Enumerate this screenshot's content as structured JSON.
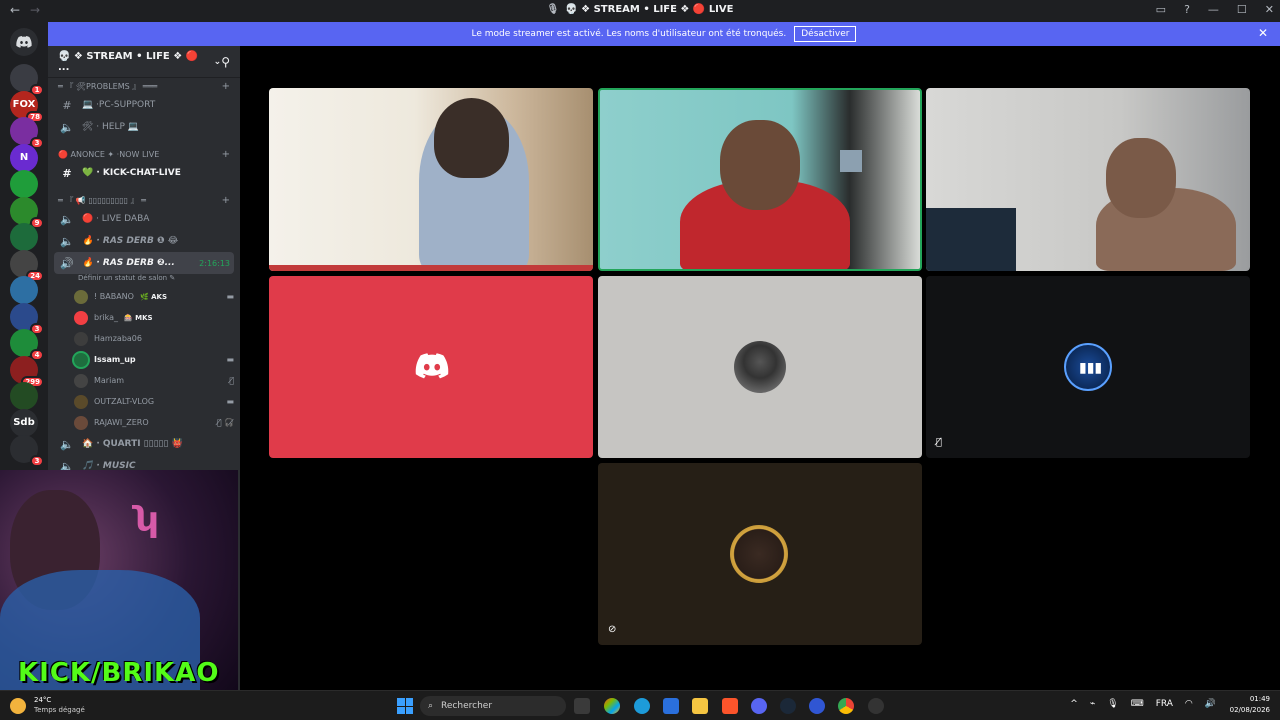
{
  "titlebar": {
    "title": "💀 ❖ STREAM • LIFE ❖ 🔴 LIVE",
    "back": "←",
    "forward": "→",
    "mic_icon": "🎙"
  },
  "banner": {
    "text": "Le mode streamer est activé. Les noms d'utilisateur ont été tronqués.",
    "button": "Désactiver",
    "close": "✕"
  },
  "guilds": [
    {
      "label": "",
      "badge": "1",
      "color": "#3a3c43"
    },
    {
      "label": "FOX",
      "badge": "78",
      "color": "#b3261e"
    },
    {
      "label": "",
      "badge": "3",
      "color": "#7a2ea0"
    },
    {
      "label": "N",
      "badge": "",
      "color": "#6a2bd0"
    },
    {
      "label": "",
      "badge": "",
      "color": "#1f9d3a"
    },
    {
      "label": "",
      "badge": "9",
      "color": "#2c8a2c"
    },
    {
      "label": "",
      "badge": "",
      "color": "#1d6b3b"
    },
    {
      "label": "",
      "badge": "24",
      "color": "#444"
    },
    {
      "label": "",
      "badge": "",
      "color": "#2d6fa3"
    },
    {
      "label": "",
      "badge": "3",
      "color": "#2b4a8c"
    },
    {
      "label": "",
      "badge": "4",
      "color": "#1e8c3a"
    },
    {
      "label": "",
      "badge": "299",
      "color": "#8c1f1f"
    },
    {
      "label": "",
      "badge": "",
      "color": "#234b23"
    },
    {
      "label": "Sdb",
      "badge": "",
      "color": "#2b2d31"
    },
    {
      "label": "",
      "badge": "3",
      "color": "#2b2d31"
    }
  ],
  "sidebar": {
    "server_name": "💀 ❖ STREAM • LIFE ❖ 🔴 ...",
    "categories": {
      "problems": "═ 『 🛠PROBLEMS 』 ═══",
      "anonce": "🔴 ANONCE ✦ ·NOW LIVE",
      "voice": "═ 『 📢 ▯▯▯▯▯▯▯▯▯ 』 ═"
    },
    "channels": {
      "pc_support": "💻 ·PC-SUPPORT",
      "help": "🛠 · HELP 💻",
      "kick_chat": "💚 · KICK-CHAT-LIVE",
      "live_daba": "🔴 · LIVE DABA",
      "ras_derb1": "🔥 · RAS DERB ❶ 😂",
      "ras_derb2": "🔥 · RAS DERB ❷...",
      "ras_derb2_time": "2:16:13",
      "status": "Définir un statut de salon ✎",
      "quarti": "🏠 · QUARTI ▯▯▯▯▯ 👹",
      "music": "🎵 · MUSIC"
    },
    "users": [
      {
        "name": "! BABANO",
        "tag": "🌿 AKS",
        "right": "▬",
        "speaking": false,
        "color": "#6b6b3a"
      },
      {
        "name": "brika_",
        "tag": "🎰 MKS",
        "right": "",
        "speaking": false,
        "color": "#f23f43"
      },
      {
        "name": "Hamzaba06",
        "tag": "",
        "right": "",
        "speaking": false,
        "color": "#3d3d3d"
      },
      {
        "name": "Issam_up",
        "tag": "",
        "right": "▬",
        "speaking": true,
        "color": "#1e6e3e"
      },
      {
        "name": "Mariam",
        "tag": "",
        "right": "🎙̸",
        "speaking": false,
        "color": "#444"
      },
      {
        "name": "OUTZALT-VLOG",
        "tag": "",
        "right": "▬",
        "speaking": false,
        "color": "#5a4a2a"
      },
      {
        "name": "RAJAWI_ZERO",
        "tag": "",
        "right": "🎙̸ 🎧̸",
        "speaking": false,
        "color": "#6a4a3a"
      }
    ]
  },
  "overlay": {
    "kick_text": "KICK/BRIKAO"
  },
  "taskbar": {
    "weather_temp": "24°C",
    "weather_desc": "Temps dégagé",
    "search_placeholder": "Rechercher",
    "lang": "FRA",
    "time": "01:49",
    "date": "02/08/2026"
  },
  "colors": {
    "discord_red": "#e03b4a",
    "discord_blurple": "#5865f2",
    "speaking_green": "#23a55a",
    "kick_green": "#53fc18"
  }
}
